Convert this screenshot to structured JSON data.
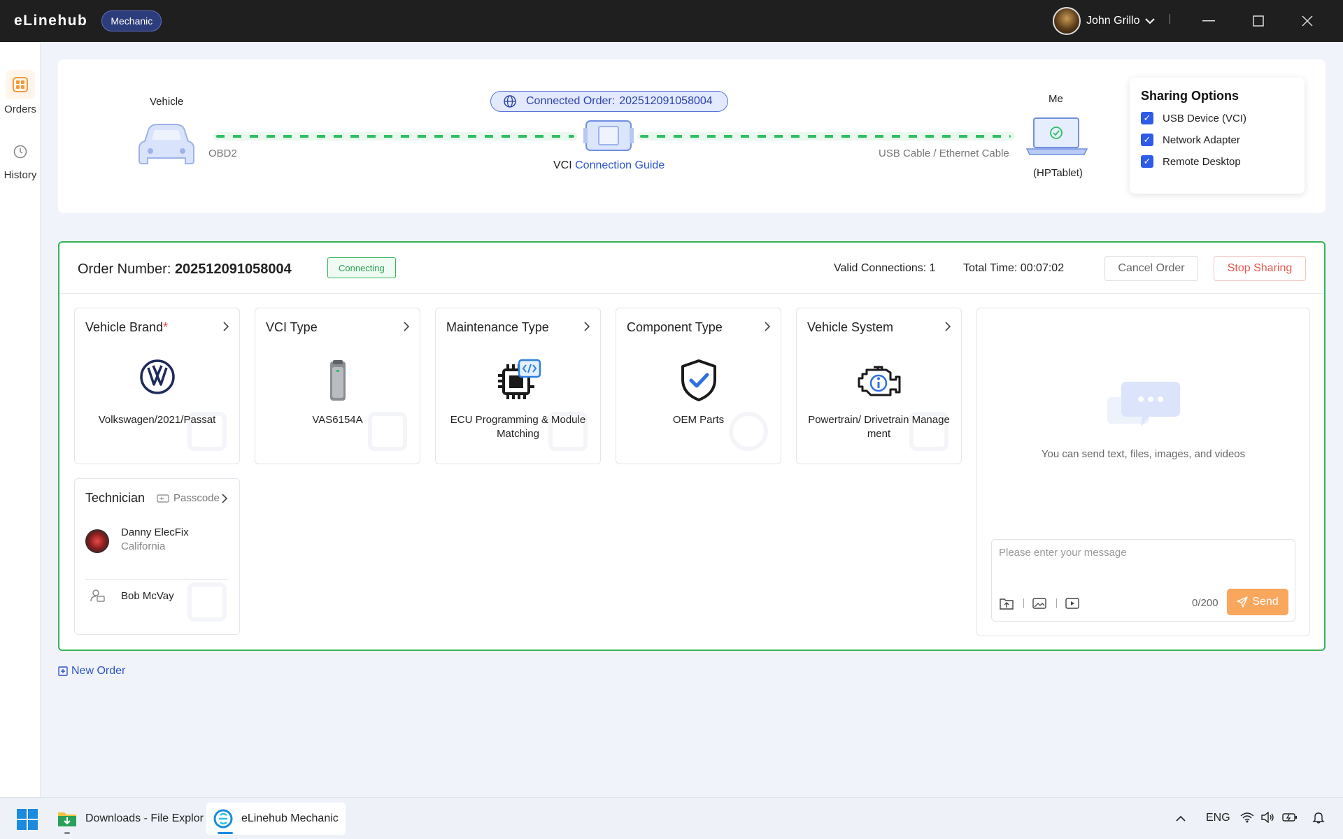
{
  "titlebar": {
    "app_name": "eLinehub",
    "role_badge": "Mechanic",
    "user_name": "John Grillo"
  },
  "leftnav": {
    "items": [
      {
        "label": "Orders",
        "icon": "grid-icon",
        "active": true
      },
      {
        "label": "History",
        "icon": "clock-icon",
        "active": false
      }
    ]
  },
  "connection": {
    "vehicle_label": "Vehicle",
    "obd_label": "OBD2",
    "connected_order_label": "Connected Order:",
    "connected_order_number": "202512091058004",
    "vci_label": "VCI",
    "guide_link": "Connection Guide",
    "cable_label": "USB Cable / Ethernet Cable",
    "me_label": "Me",
    "device_label": "(HPTablet)",
    "accent": "#2fbf63"
  },
  "sharing": {
    "title": "Sharing Options",
    "options": [
      {
        "label": "USB Device (VCI)",
        "checked": true
      },
      {
        "label": "Network Adapter",
        "checked": true
      },
      {
        "label": "Remote Desktop",
        "checked": true
      }
    ]
  },
  "order": {
    "number_label": "Order Number:",
    "number": "202512091058004",
    "status": "Connecting",
    "valid_connections": "Valid Connections: 1",
    "total_time": "Total Time: 00:07:02",
    "cancel_label": "Cancel Order",
    "stop_label": "Stop Sharing",
    "cards": [
      {
        "title": "Vehicle Brand",
        "required_mark": "*",
        "value": "Volkswagen/2021/Passat",
        "icon": "vw-logo-icon"
      },
      {
        "title": "VCI Type",
        "value": "VAS6154A",
        "icon": "vci-device-icon"
      },
      {
        "title": "Maintenance Type",
        "value": "ECU Programming & Module Matching",
        "icon": "ecu-chip-icon"
      },
      {
        "title": "Component Type",
        "value": "OEM Parts",
        "icon": "shield-check-icon"
      },
      {
        "title": "Vehicle System",
        "value": "Powertrain/ Drivetrain Manage ment",
        "icon": "engine-info-icon"
      }
    ],
    "technician": {
      "title": "Technician",
      "passcode_label": "Passcode",
      "people": [
        {
          "name": "Danny ElecFix",
          "location": "California"
        },
        {
          "name": "Bob McVay"
        }
      ]
    },
    "chat": {
      "empty_text": "You can send text, files, images, and videos",
      "placeholder": "Please enter your message",
      "counter": "0/200",
      "send_label": "Send"
    }
  },
  "new_order_label": "New Order",
  "taskbar": {
    "items": [
      {
        "label": "Downloads - File Explor"
      },
      {
        "label": "eLinehub Mechanic"
      }
    ],
    "lang": "ENG"
  }
}
